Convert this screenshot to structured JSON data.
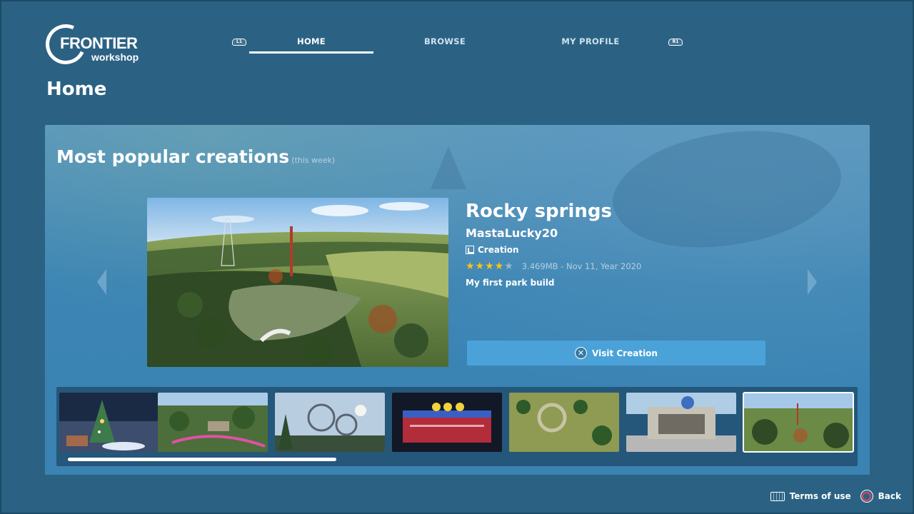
{
  "brand": {
    "name": "FRONTIER",
    "sub": "workshop"
  },
  "nav": {
    "left_bumper": "L1",
    "right_bumper": "R1",
    "tabs": [
      {
        "label": "HOME",
        "active": true
      },
      {
        "label": "BROWSE",
        "active": false
      },
      {
        "label": "MY PROFILE",
        "active": false
      }
    ]
  },
  "page_title": "Home",
  "section": {
    "title": "Most popular creations",
    "note": "(this week)"
  },
  "featured": {
    "title": "Rocky springs",
    "author": "MastaLucky20",
    "type": "Creation",
    "rating": 4.5,
    "meta": "3.469MB - Nov 11, Year 2020",
    "description": "My first park build",
    "visit_label": "Visit Creation"
  },
  "thumbnails": [
    {
      "name": "christmas-tree-scene"
    },
    {
      "name": "pink-coaster-park"
    },
    {
      "name": "loop-coaster"
    },
    {
      "name": "neon-stage-building"
    },
    {
      "name": "jungle-ruins"
    },
    {
      "name": "planet-coaster-entrance"
    },
    {
      "name": "rocky-springs-park",
      "selected": true
    }
  ],
  "strip_scroll": {
    "position": 0.0,
    "visible_fraction": 0.345
  },
  "footer": {
    "terms_label": "Terms of use",
    "back_label": "Back"
  },
  "colors": {
    "background": "#2b6284",
    "panel": "#3b84b4",
    "button": "#4aa2d9",
    "star": "#f5c518"
  }
}
